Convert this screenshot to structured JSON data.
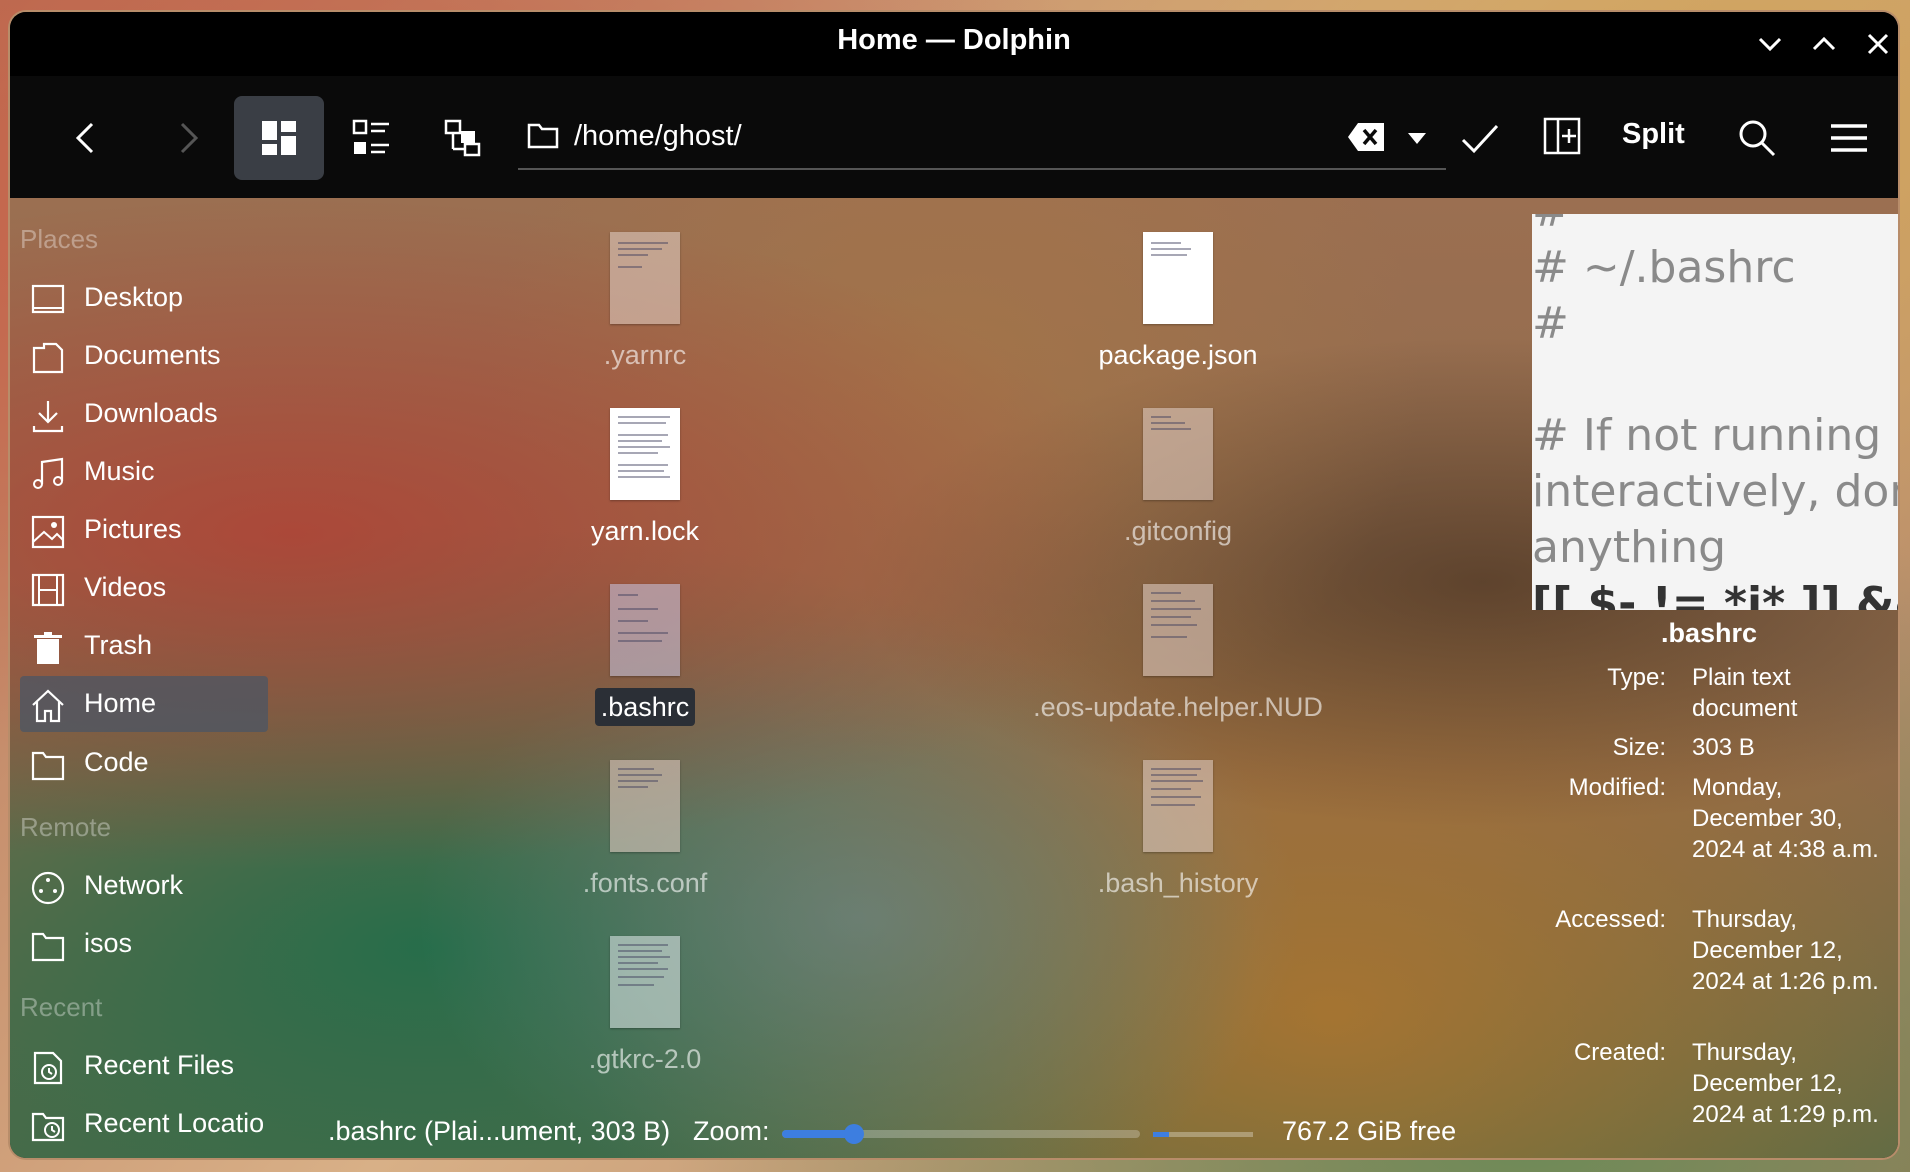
{
  "window": {
    "title": "Home — Dolphin"
  },
  "toolbar": {
    "path": "/home/ghost/",
    "split_label": "Split"
  },
  "sidebar": {
    "sections": {
      "places": "Places",
      "remote": "Remote",
      "recent": "Recent"
    },
    "places": [
      {
        "label": "Desktop",
        "icon": "desktop-icon"
      },
      {
        "label": "Documents",
        "icon": "documents-icon"
      },
      {
        "label": "Downloads",
        "icon": "downloads-icon"
      },
      {
        "label": "Music",
        "icon": "music-icon"
      },
      {
        "label": "Pictures",
        "icon": "pictures-icon"
      },
      {
        "label": "Videos",
        "icon": "videos-icon"
      },
      {
        "label": "Trash",
        "icon": "trash-icon"
      },
      {
        "label": "Home",
        "icon": "home-icon"
      },
      {
        "label": "Code",
        "icon": "folder-icon"
      }
    ],
    "remote": [
      {
        "label": "Network",
        "icon": "network-icon"
      },
      {
        "label": "isos",
        "icon": "folder-icon"
      }
    ],
    "recent": [
      {
        "label": "Recent Files",
        "icon": "recent-files-icon"
      },
      {
        "label": "Recent Locatio",
        "icon": "recent-locations-icon"
      }
    ]
  },
  "files": [
    {
      "name": ".yarnrc"
    },
    {
      "name": "package.json"
    },
    {
      "name": "yarn.lock"
    },
    {
      "name": ".gitconfig"
    },
    {
      "name": ".bashrc"
    },
    {
      "name": ".eos-update.helper.NUD"
    },
    {
      "name": ".fonts.conf"
    },
    {
      "name": ".bash_history"
    },
    {
      "name": ".gtkrc-2.0"
    }
  ],
  "info": {
    "preview_lines": [
      "#",
      "# ~/.bashrc",
      "#",
      "",
      "# If not running",
      "interactively, don",
      "anything",
      "[[ $- != *i* ]] &&"
    ],
    "name": ".bashrc",
    "type_label": "Type:",
    "type_value": "Plain text document",
    "size_label": "Size:",
    "size_value": "303 B",
    "modified_label": "Modified:",
    "modified_value": "Monday, December 30, 2024 at 4:38 a.m.",
    "accessed_label": "Accessed:",
    "accessed_value": "Thursday, December 12, 2024 at 1:26 p.m.",
    "created_label": "Created:",
    "created_value": "Thursday, December 12, 2024 at 1:29 p.m."
  },
  "statusbar": {
    "selection": ".bashrc (Plai...ument, 303 B)",
    "zoom_label": "Zoom:",
    "zoom_level": 0.2,
    "free_space": "767.2 GiB free",
    "disk_used_fraction": 0.16
  },
  "colors": {
    "accent": "#3d7ee0",
    "titlebar": "#000000"
  }
}
